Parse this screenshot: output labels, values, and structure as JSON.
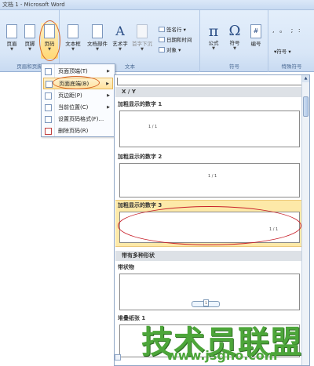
{
  "window": {
    "title": "文档 1 - Microsoft Word"
  },
  "ribbon": {
    "groups": {
      "header_footer": {
        "label": "页眉和页脚",
        "buttons": {
          "header": "页眉",
          "footer": "页脚",
          "page_number": "页码"
        }
      },
      "text": {
        "label": "文本",
        "buttons": {
          "textbox": "文本框",
          "quickparts": "文档部件",
          "wordart": "艺术字",
          "dropcap": "首字下沉"
        },
        "small": {
          "signature": "签名行",
          "datetime": "日期和时间",
          "object": "对象"
        }
      },
      "symbols": {
        "label": "符号",
        "buttons": {
          "equation": "公式",
          "symbol": "符号",
          "number": "编号"
        },
        "glyphs": {
          "equation": "π",
          "symbol": "Ω",
          "number": "#"
        }
      },
      "special": {
        "label": "特殊符号",
        "glyphs": ", 。 ; :",
        "button": "符号"
      }
    }
  },
  "menu": {
    "items": [
      {
        "label": "页面顶端(T)",
        "has_submenu": true
      },
      {
        "label": "页面底端(B)",
        "has_submenu": true,
        "active": true
      },
      {
        "label": "页边距(P)",
        "has_submenu": true
      },
      {
        "label": "当前位置(C)",
        "has_submenu": true
      },
      {
        "label": "设置页码格式(F)...",
        "has_submenu": false
      },
      {
        "label": "删除页码(R)",
        "has_submenu": false
      }
    ]
  },
  "gallery": {
    "section_xy": "X / Y",
    "items": [
      {
        "caption": "加粗显示的数字 1",
        "number_text": "1 / 1"
      },
      {
        "caption": "加粗显示的数字 2",
        "number_text": "1 / 1"
      },
      {
        "caption": "加粗显示的数字 3",
        "number_text": "1 / 1"
      }
    ],
    "section_shapes": "带有多种形状",
    "ribbon_caption": "带状物",
    "ribbon_number": "1",
    "last_caption": "堆叠纸张 1"
  },
  "watermark": {
    "text": "技术员联盟",
    "url": "www.jsgho.com"
  },
  "colors": {
    "highlight_ellipse": "#d8662a",
    "watermark": "#4da63a",
    "selected_bg": "#fde9a8"
  }
}
